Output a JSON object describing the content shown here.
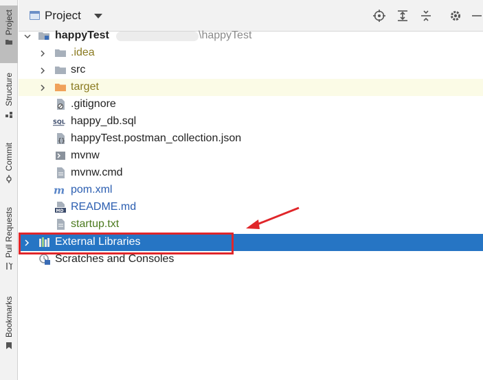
{
  "sidebar": {
    "tabs": [
      {
        "label": "Project",
        "active": true
      },
      {
        "label": "Structure",
        "active": false
      },
      {
        "label": "Commit",
        "active": false
      },
      {
        "label": "Pull Requests",
        "active": false
      },
      {
        "label": "Bookmarks",
        "active": false
      }
    ]
  },
  "header": {
    "title": "Project",
    "icons": [
      "locate-icon",
      "expand-all-icon",
      "collapse-all-icon",
      "gear-icon",
      "minimize-icon"
    ]
  },
  "tree": {
    "root": {
      "name": "happyTest",
      "path": "\\happyTest"
    },
    "items": [
      {
        "label": ".idea",
        "type": "folder"
      },
      {
        "label": "src",
        "type": "folder"
      },
      {
        "label": "target",
        "type": "folder-orange"
      },
      {
        "label": ".gitignore",
        "type": "file"
      },
      {
        "label": "happy_db.sql",
        "type": "sql"
      },
      {
        "label": "happyTest.postman_collection.json",
        "type": "json"
      },
      {
        "label": "mvnw",
        "type": "shell"
      },
      {
        "label": "mvnw.cmd",
        "type": "file"
      },
      {
        "label": "pom.xml",
        "type": "maven"
      },
      {
        "label": "README.md",
        "type": "markdown"
      },
      {
        "label": "startup.txt",
        "type": "text"
      }
    ],
    "external": {
      "label": "External Libraries"
    },
    "scratches": {
      "label": "Scratches and Consoles"
    }
  },
  "colors": {
    "selection": "#2675c4",
    "highlight_row": "#fbfbe6",
    "callout": "#e0262a",
    "folder": "#a7b0bb",
    "folder_orange": "#f0a25a"
  }
}
